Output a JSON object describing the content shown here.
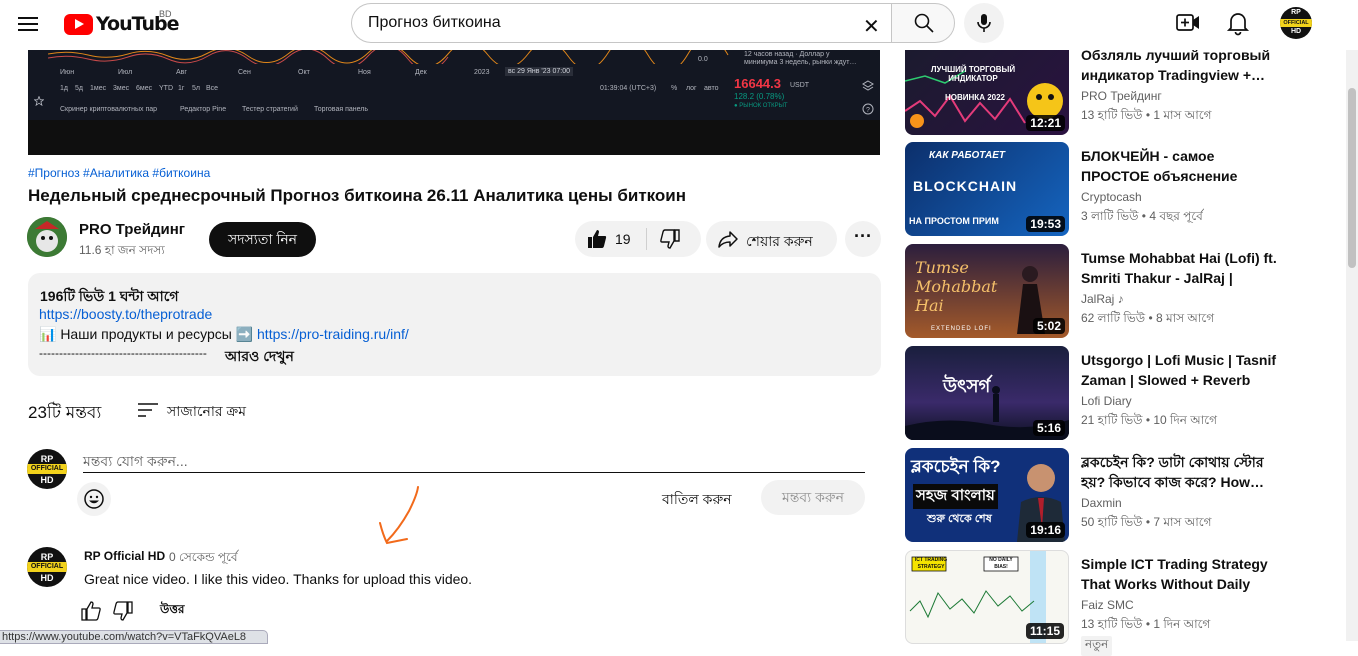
{
  "header": {
    "logo_text": "YouTube",
    "country_code": "BD",
    "search_value": "Прогноз биткоина",
    "avatar_text_top": "RP",
    "avatar_text_mid": "OFFICIAL",
    "avatar_text_bot": "HD"
  },
  "player": {
    "months": [
      "Июн",
      "Июл",
      "Авг",
      "Сен",
      "Окт",
      "Ноя",
      "Дек",
      "2023"
    ],
    "date_badge": "вс 29 Янв '23  07:00",
    "timeframes": [
      "1д",
      "5д",
      "1мес",
      "3мес",
      "6мес",
      "YTD",
      "1г",
      "5л",
      "Все"
    ],
    "clock": "01:39:04 (UTC+3)",
    "scale_opts": [
      "%",
      "лог",
      "авто"
    ],
    "bottom_tabs": [
      "Скринер криптовалютных пар",
      "Редактор Pine",
      "Тестер стратегий",
      "Торговая панель"
    ],
    "price": "16644.3",
    "price_unit": "USDT",
    "price_change": "128.2 (0.78%)",
    "market_status": "● РЫНОК ОТКРЫТ",
    "tooltip_line1": "12 часов назад · Доллар у",
    "tooltip_line2": "минимума 3 недель, рынки ждут…",
    "axis_val": "0.0"
  },
  "video": {
    "tags": "#Прогноз #Аналитика #биткоина",
    "title": "Недельный среднесрочный Прогноз биткоина 26.11 Аналитика цены биткоин",
    "channel_name": "PRO Трейдинг",
    "subscribers": "11.6 হা জন সদস্য",
    "subscribe_label": "সদস্যতা নিন",
    "like_count": "19",
    "share_label": "শেয়ার করুন",
    "more_label": "···"
  },
  "description": {
    "views_time": "196টি ভিউ  1 ঘন্টা আগে",
    "link1": "https://boosty.to/theprotrade",
    "line2_prefix": "📊 Наши продукты и ресурсы ➡️ ",
    "line2_link": "https://pro-traiding.ru/inf/",
    "line3": "------------------------------------------",
    "more": "আরও দেখুন"
  },
  "comments": {
    "count": "23টি মন্তব্য",
    "sort_label": "সাজানোর ক্রম",
    "placeholder": "মন্তব্য যোগ করুন...",
    "cancel": "বাতিল করুন",
    "submit": "মন্তব্য করুন",
    "first": {
      "author": "RP Official HD",
      "time": "0 সেকেন্ড পূর্বে",
      "text": "Great nice video. I like this video. Thanks for upload this video.",
      "reply": "উত্তর"
    }
  },
  "status_url": "https://www.youtube.com/watch?v=VTaFkQVAeL8",
  "sidebar": [
    {
      "title": "Обзляль лучший торговый индикатор Tradingview +…",
      "channel": "PRO Трейдинг",
      "meta": "13 হাটি ভিউ  • 1 মাস আগে",
      "duration": "12:21",
      "thumb_text": "ЛУЧШИЙ ТОРГОВЫЙ ИНДИКАТОР",
      "thumb_text2": "НОВИНКА 2022"
    },
    {
      "title": "БЛОКЧЕЙН - самое ПРОСТОЕ объяснение работы…",
      "channel": "Cryptocash",
      "meta": "3 লাটি ভিউ  • 4 বছর পূর্বে",
      "duration": "19:53",
      "thumb_text": "КАК РАБОТАЕТ",
      "thumb_text2": "BLOCKCHAIN",
      "thumb_text3": "НА ПРОСТОМ ПРИМ"
    },
    {
      "title": "Tumse Mohabbat Hai (Lofi) ft. Smriti Thakur - JalRaj | Latest…",
      "channel": "JalRaj ♪",
      "meta": "62 লাটি ভিউ  • 8 মাস আগে",
      "duration": "5:02",
      "thumb_text": "Tumse Mohabbat Hai",
      "thumb_text2": "EXTENDED LOFI"
    },
    {
      "title": "Utsgorgo | Lofi Music | Tasnif Zaman | Slowed + Reverb Son…",
      "channel": "Lofi Diary",
      "meta": "21 হাটি ভিউ  • 10 দিন আগে",
      "duration": "5:16",
      "thumb_text": "উৎসর্গ"
    },
    {
      "title": "ব্লকচেইন কি? ডাটা কোথায় স্টোর হয়? কিভাবে কাজ করে? How…",
      "channel": "Daxmin",
      "meta": "50 হাটি ভিউ  • 7 মাস আগে",
      "duration": "19:16",
      "thumb_text": "ব্লকচেইন কি?",
      "thumb_text2": "সহজ বাংলায়",
      "thumb_text3": "শুরু থেকে শেষ"
    },
    {
      "title": "Simple ICT Trading Strategy That Works Without Daily Bias!",
      "channel": "Faiz SMC",
      "meta": "13 হাটি ভিউ  • 1 দিন আগে",
      "duration": "11:15",
      "badge": "নতুন",
      "thumb_text": "ICT TRADING STRATEGY",
      "thumb_text2": "NO DAILY BIAS!"
    }
  ]
}
